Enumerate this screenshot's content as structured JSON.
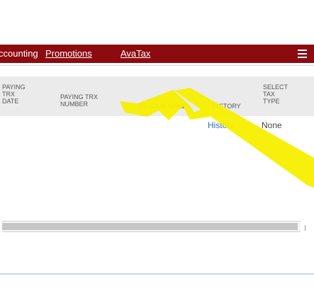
{
  "nav": {
    "accounting": "ccounting",
    "promotions": "Promotions",
    "avatax": "AvaTax"
  },
  "table": {
    "headers": {
      "trx_date": "PAYING\nTRX\nDATE",
      "trx_number": "PAYING TRX\nNUMBER",
      "vendor_name": "VENDOR NAME",
      "history": "HISTORY",
      "select_tax": "SELECT\nTAX\nTYPE"
    },
    "row": {
      "history_link": "History",
      "select_tax_value": "None"
    }
  },
  "colors": {
    "nav_bar": "#8c0b10",
    "highlight": "#f7ef00"
  },
  "icons": {
    "menu": "hamburger-icon"
  }
}
